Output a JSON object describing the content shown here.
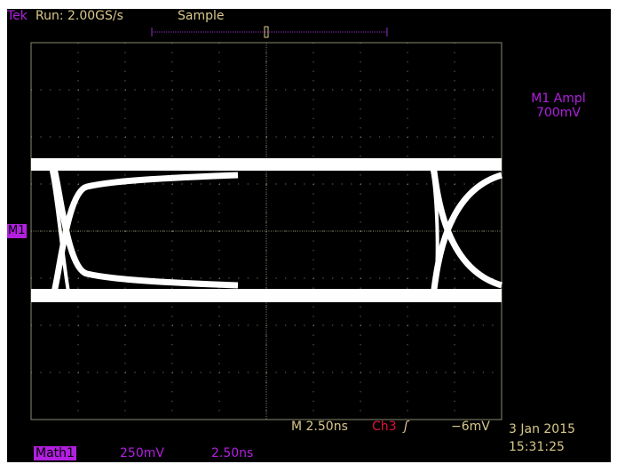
{
  "header": {
    "brand": "Tek",
    "run": "Run: 2.00GS/s",
    "mode": "Sample"
  },
  "measurement": {
    "label": "M1 Ampl",
    "value": "700mV"
  },
  "marker": "M1",
  "status": {
    "timebase": "M 2.50ns",
    "channel": "Ch3",
    "trigger_slope": "rising-edge-icon",
    "trigger_level": "−6mV",
    "date": "3 Jan 2015",
    "time": "15:31:25"
  },
  "math": {
    "label": "Math1",
    "scale": "250mV",
    "time": "2.50ns"
  },
  "colors": {
    "text": "#d8c88a",
    "math": "#b21fe0",
    "ch3": "#e0103a",
    "trace": "#ffffff"
  }
}
